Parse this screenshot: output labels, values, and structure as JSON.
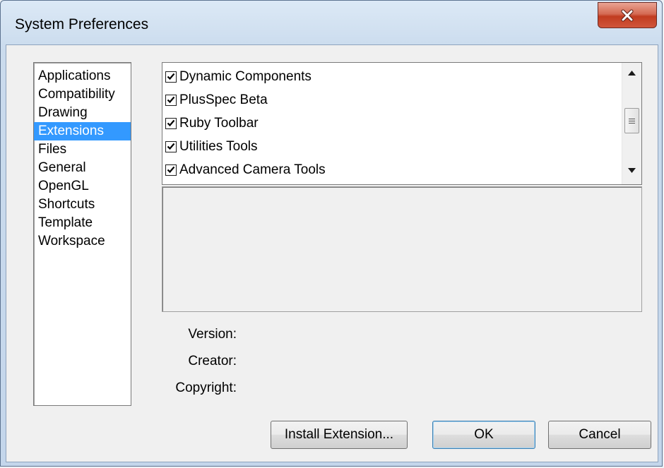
{
  "window": {
    "title": "System Preferences",
    "close_icon": "close-icon"
  },
  "categories": [
    {
      "label": "Applications",
      "selected": false
    },
    {
      "label": "Compatibility",
      "selected": false
    },
    {
      "label": "Drawing",
      "selected": false
    },
    {
      "label": "Extensions",
      "selected": true
    },
    {
      "label": "Files",
      "selected": false
    },
    {
      "label": "General",
      "selected": false
    },
    {
      "label": "OpenGL",
      "selected": false
    },
    {
      "label": "Shortcuts",
      "selected": false
    },
    {
      "label": "Template",
      "selected": false
    },
    {
      "label": "Workspace",
      "selected": false
    }
  ],
  "extensions": [
    {
      "label": "Dynamic Components",
      "checked": true
    },
    {
      "label": "PlusSpec Beta",
      "checked": true
    },
    {
      "label": "Ruby Toolbar",
      "checked": true
    },
    {
      "label": "Utilities Tools",
      "checked": true
    },
    {
      "label": "Advanced Camera Tools",
      "checked": true
    }
  ],
  "details": {
    "version_label": "Version:",
    "creator_label": "Creator:",
    "copyright_label": "Copyright:"
  },
  "buttons": {
    "install": "Install Extension...",
    "ok": "OK",
    "cancel": "Cancel"
  },
  "colors": {
    "selection": "#3399ff",
    "close_button": "#c13c20"
  }
}
